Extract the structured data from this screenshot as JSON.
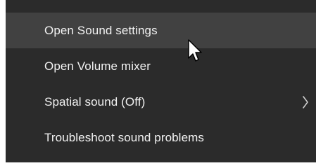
{
  "context_menu": {
    "items": [
      {
        "label": "Open Sound settings",
        "hovered": true
      },
      {
        "label": "Open Volume mixer",
        "hovered": false
      },
      {
        "label": "Spatial sound (Off)",
        "hovered": false,
        "has_submenu": true
      },
      {
        "label": "Troubleshoot sound problems",
        "hovered": false
      }
    ],
    "submenu_icon": "chevron-right-icon",
    "colors": {
      "background": "#2b2b2b",
      "hover": "#414141",
      "text": "#f2f2f2",
      "outer": "#ffffff"
    }
  },
  "cursor": {
    "icon": "mouse-pointer-icon"
  }
}
